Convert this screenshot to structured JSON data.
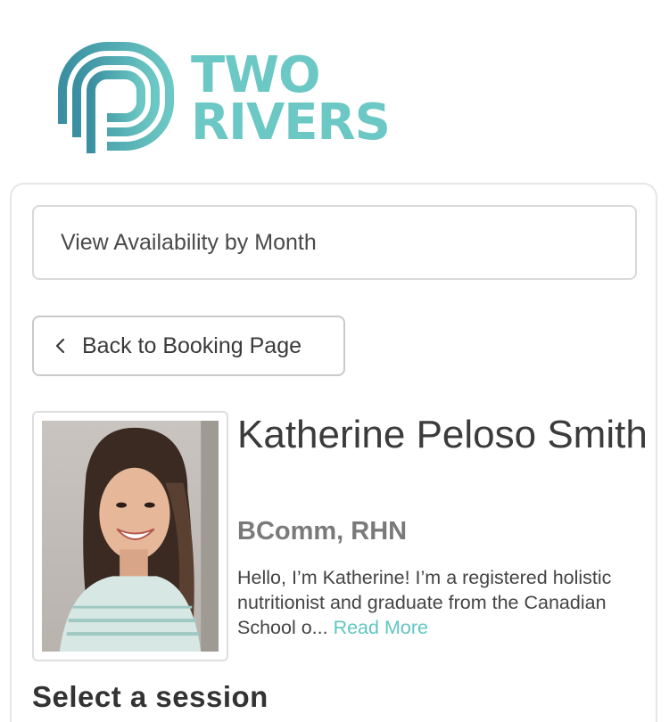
{
  "brand": {
    "line1": "TWO",
    "line2": "RIVERS",
    "colors": {
      "teal_light": "#6cc8c4",
      "teal_dark": "#3a8fa0"
    }
  },
  "availability_select": {
    "label": "View Availability by Month"
  },
  "back_button": {
    "label": "Back to Booking Page",
    "icon": "chevron-left-icon"
  },
  "profile": {
    "name": "Katherine Peloso Smith",
    "credentials": "BComm, RHN",
    "bio": "Hello, I’m Katherine! I’m a registered holistic nutritionist and graduate from the Canadian School o...",
    "read_more": "Read More",
    "photo_icon": "profile-photo"
  },
  "sessions": {
    "title": "Select a session"
  }
}
